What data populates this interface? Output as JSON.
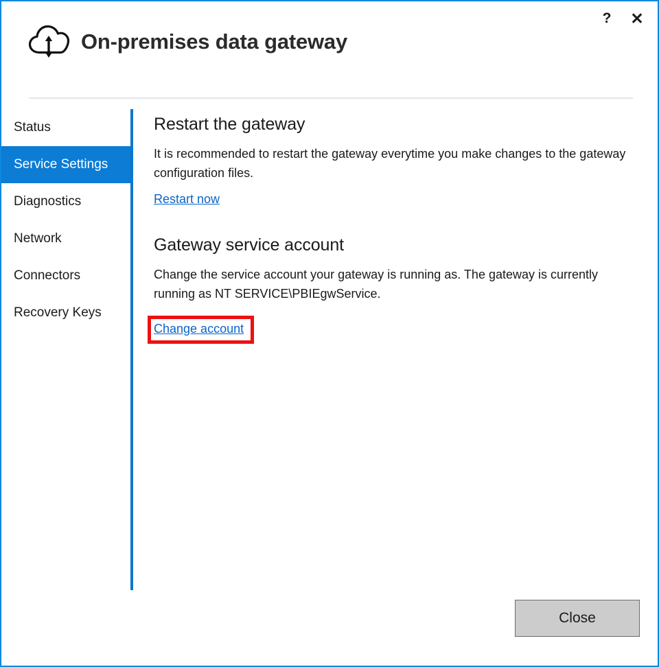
{
  "window": {
    "title": "On-premises data gateway",
    "icon": "cloud-sync-icon",
    "accent_color": "#0c7cd5",
    "border_color": "#0f87e0",
    "help_label": "?",
    "close_label": "✕"
  },
  "sidebar": {
    "items": [
      {
        "label": "Status",
        "selected": false
      },
      {
        "label": "Service Settings",
        "selected": true
      },
      {
        "label": "Diagnostics",
        "selected": false
      },
      {
        "label": "Network",
        "selected": false
      },
      {
        "label": "Connectors",
        "selected": false
      },
      {
        "label": "Recovery Keys",
        "selected": false
      }
    ]
  },
  "main": {
    "sections": [
      {
        "heading": "Restart the gateway",
        "body": "It is recommended to restart the gateway everytime you make changes to the gateway configuration files.",
        "link": "Restart now"
      },
      {
        "heading": "Gateway service account",
        "body": "Change the service account your gateway is running as. The gateway is currently running as NT SERVICE\\PBIEgwService.",
        "link": "Change account",
        "highlighted": true,
        "highlight_color": "#ee1111"
      }
    ]
  },
  "footer": {
    "close_label": "Close"
  }
}
